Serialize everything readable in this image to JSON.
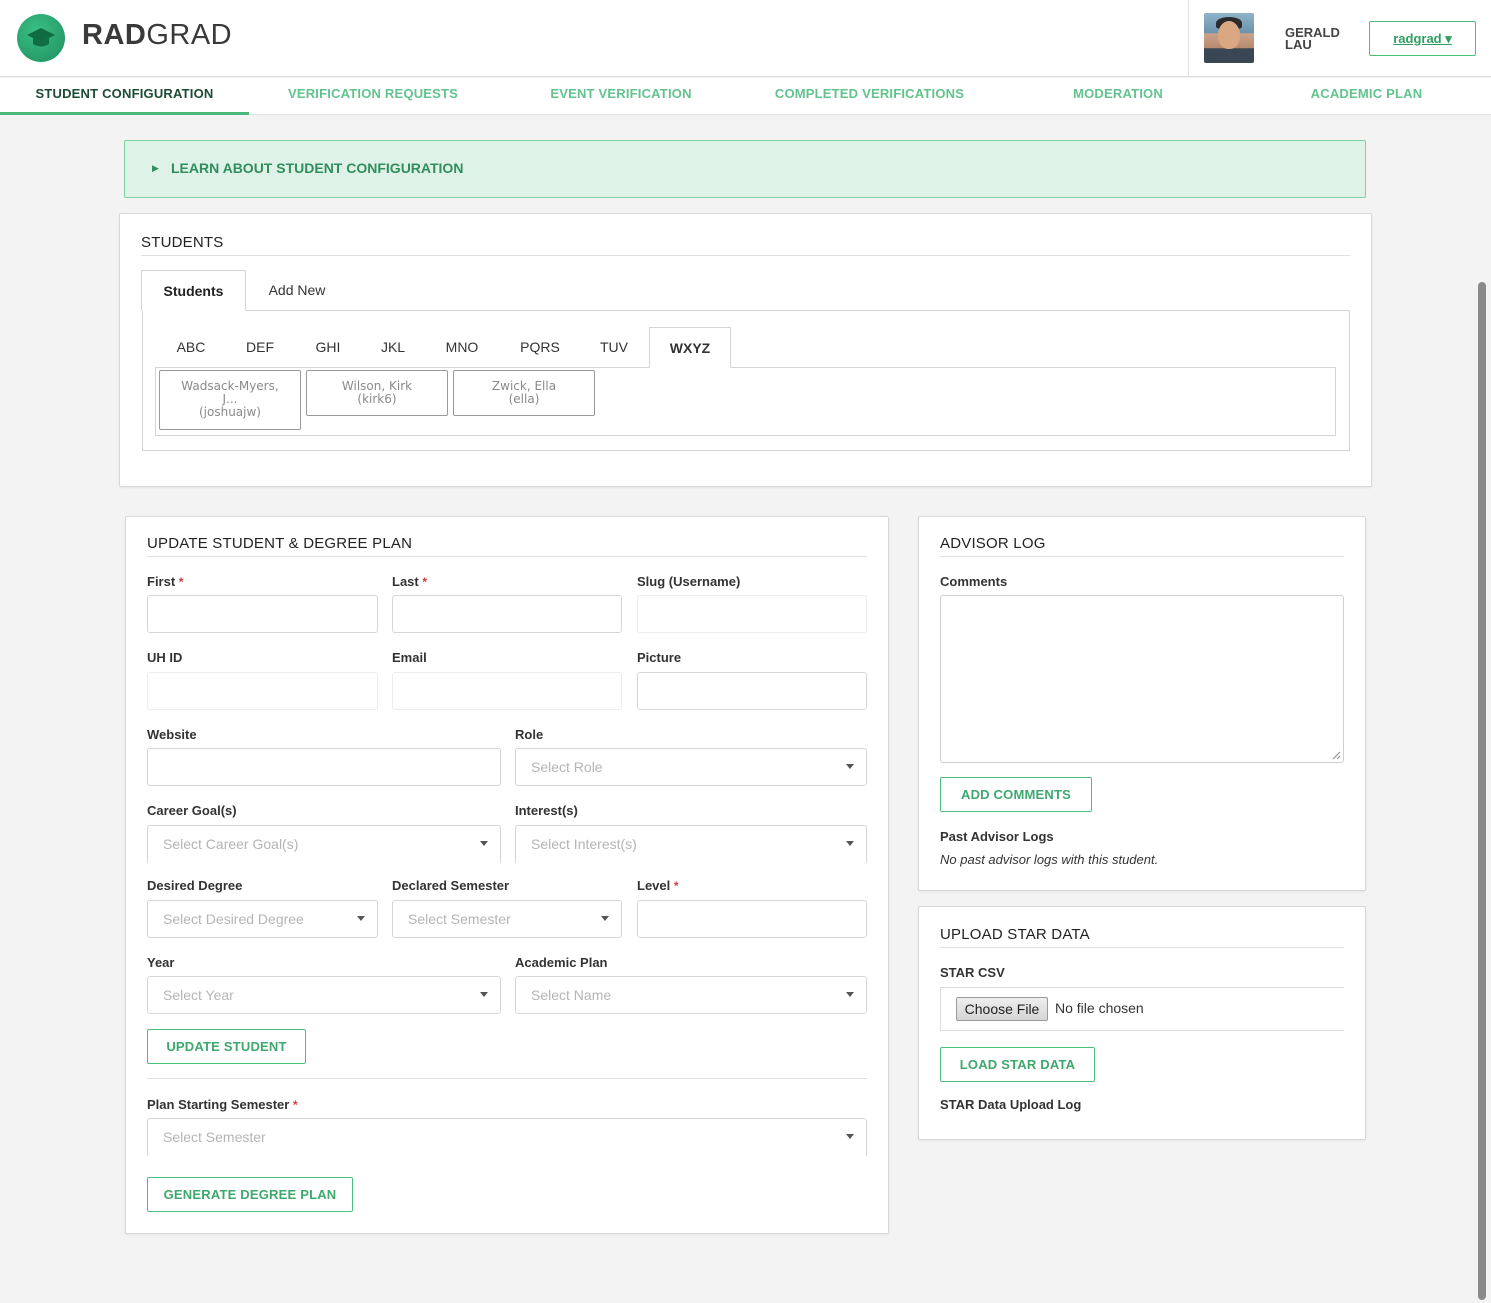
{
  "header": {
    "brand_bold": "RAD",
    "brand_rest": "GRAD",
    "user_first": "GERALD",
    "user_last": "LAU",
    "user_menu_label": "radgrad ▾"
  },
  "nav": {
    "tabs": [
      {
        "label": "STUDENT CONFIGURATION"
      },
      {
        "label": "VERIFICATION REQUESTS"
      },
      {
        "label": "EVENT VERIFICATION"
      },
      {
        "label": "COMPLETED VERIFICATIONS"
      },
      {
        "label": "MODERATION"
      },
      {
        "label": "ACADEMIC PLAN"
      }
    ]
  },
  "learn_banner": {
    "label": "LEARN ABOUT STUDENT CONFIGURATION"
  },
  "students_panel": {
    "title": "STUDENTS",
    "tabs": [
      "Students",
      "Add New"
    ],
    "letters": [
      "ABC",
      "DEF",
      "GHI",
      "JKL",
      "MNO",
      "PQRS",
      "TUV",
      "WXYZ"
    ],
    "students": [
      {
        "line1": "Wadsack-Myers,",
        "line2": "J...",
        "line3": "(joshuajw)"
      },
      {
        "line1": "Wilson, Kirk",
        "line2": "(kirk6)"
      },
      {
        "line1": "Zwick, Ella",
        "line2": "(ella)"
      }
    ]
  },
  "update_panel": {
    "title": "UPDATE STUDENT & DEGREE PLAN",
    "labels": {
      "first": "First",
      "last": "Last",
      "slug": "Slug (Username)",
      "uhid": "UH ID",
      "email": "Email",
      "picture": "Picture",
      "website": "Website",
      "role": "Role",
      "career_goals": "Career Goal(s)",
      "interests": "Interest(s)",
      "desired_degree": "Desired Degree",
      "declared_semester": "Declared Semester",
      "level": "Level",
      "year": "Year",
      "academic_plan": "Academic Plan",
      "plan_starting_semester": "Plan Starting Semester"
    },
    "required_mark": "*",
    "placeholders": {
      "role": "Select Role",
      "career_goals": "Select Career Goal(s)",
      "interests": "Select Interest(s)",
      "desired_degree": "Select Desired Degree",
      "declared_semester": "Select Semester",
      "year": "Select Year",
      "academic_plan": "Select Name",
      "plan_starting_semester": "Select Semester"
    },
    "update_button": "UPDATE STUDENT",
    "generate_button": "GENERATE DEGREE PLAN"
  },
  "advisor_panel": {
    "title": "ADVISOR LOG",
    "comments_label": "Comments",
    "add_button": "ADD COMMENTS",
    "past_label": "Past Advisor Logs",
    "past_empty": "No past advisor logs with this student."
  },
  "star_panel": {
    "title": "UPLOAD STAR DATA",
    "csv_label": "STAR CSV",
    "choose_file": "Choose File",
    "no_file": "No file chosen",
    "load_button": "LOAD STAR DATA",
    "log_label": "STAR Data Upload Log"
  },
  "colors": {
    "accent": "#48b979",
    "accent_text": "#3fa86e",
    "banner_bg": "#dff2e8",
    "required": "#d9383a"
  }
}
